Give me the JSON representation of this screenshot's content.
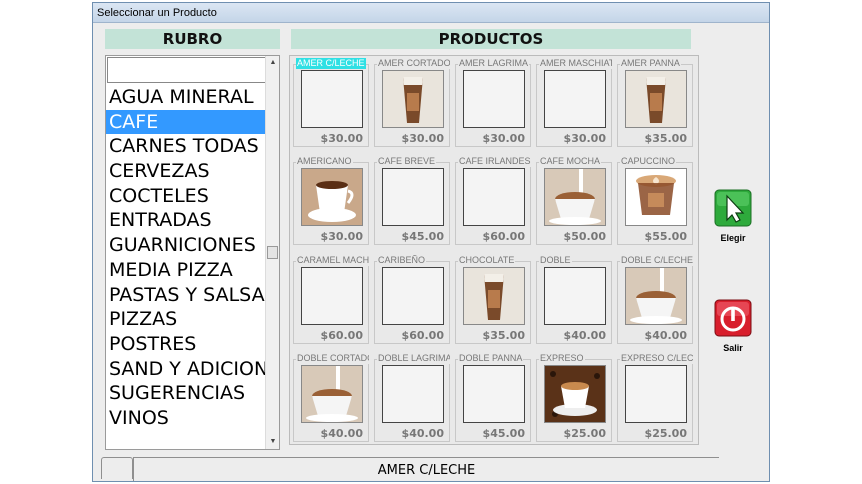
{
  "window": {
    "title": "Seleccionar un Producto"
  },
  "rubro": {
    "header": "RUBRO",
    "search_value": "",
    "selected_index": 1,
    "items": [
      "AGUA MINERAL",
      "CAFE",
      "CARNES TODAS",
      "CERVEZAS",
      "COCTELES",
      "ENTRADAS",
      "GUARNICIONES",
      "MEDIA PIZZA",
      "PASTAS Y SALSAS",
      "PIZZAS",
      "POSTRES",
      "SAND Y ADICIONES",
      "SUGERENCIAS",
      "VINOS"
    ]
  },
  "productos": {
    "header": "PRODUCTOS",
    "items": [
      {
        "name": "AMER C/LECHE",
        "price": "$30.00",
        "image": "blank",
        "highlighted": true
      },
      {
        "name": "AMER CORTADO",
        "price": "$30.00",
        "image": "coffee-cup-icon"
      },
      {
        "name": "AMER LAGRIMA",
        "price": "$30.00",
        "image": "blank"
      },
      {
        "name": "AMER MASCHIATO",
        "price": "$30.00",
        "image": "blank"
      },
      {
        "name": "AMER PANNA",
        "price": "$35.00",
        "image": "coffee-cup-icon"
      },
      {
        "name": "AMERICANO",
        "price": "$30.00",
        "image": "coffee-mug-icon"
      },
      {
        "name": "CAFE BREVE",
        "price": "$45.00",
        "image": "blank"
      },
      {
        "name": "CAFE IRLANDES",
        "price": "$60.00",
        "image": "blank"
      },
      {
        "name": "CAFE MOCHA",
        "price": "$50.00",
        "image": "coffee-pour-icon"
      },
      {
        "name": "CAPUCCINO",
        "price": "$55.00",
        "image": "cappuccino-icon"
      },
      {
        "name": "CARAMEL MACHIATO",
        "price": "$60.00",
        "image": "blank"
      },
      {
        "name": "CARIBEÑO",
        "price": "$60.00",
        "image": "blank"
      },
      {
        "name": "CHOCOLATE",
        "price": "$35.00",
        "image": "coffee-cup-icon"
      },
      {
        "name": "DOBLE",
        "price": "$40.00",
        "image": "blank"
      },
      {
        "name": "DOBLE C/LECHE",
        "price": "$40.00",
        "image": "coffee-pour-icon"
      },
      {
        "name": "DOBLE CORTADO",
        "price": "$40.00",
        "image": "coffee-pour-icon"
      },
      {
        "name": "DOBLE LAGRIMA",
        "price": "$40.00",
        "image": "blank"
      },
      {
        "name": "DOBLE PANNA",
        "price": "$45.00",
        "image": "blank"
      },
      {
        "name": "EXPRESO",
        "price": "$25.00",
        "image": "espresso-icon"
      },
      {
        "name": "EXPRESO C/LECHE",
        "price": "$25.00",
        "image": "blank"
      }
    ]
  },
  "buttons": {
    "elegir_label": "Elegir",
    "salir_label": "Salir"
  },
  "status": {
    "selected_product": "AMER C/LECHE"
  },
  "colors": {
    "header_bg": "#c3e3d7",
    "selection": "#3399ff",
    "highlight": "#2fe0e4",
    "elegir": "#2eaa3c",
    "salir": "#d81e2c"
  }
}
